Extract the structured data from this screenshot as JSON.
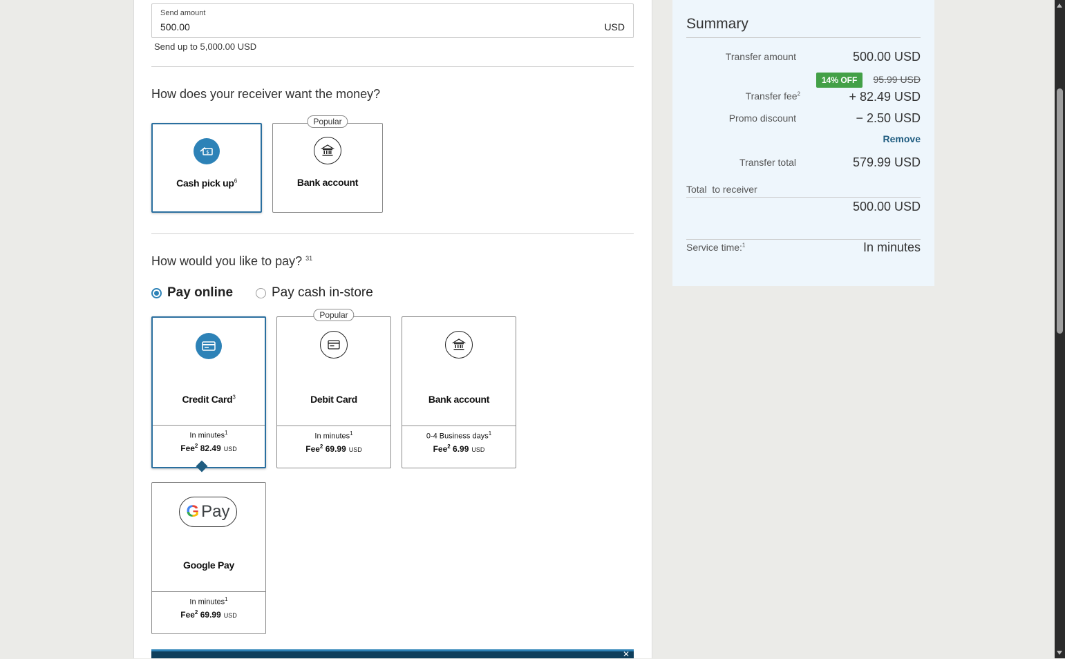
{
  "send": {
    "label": "Send amount",
    "value": "500.00",
    "currency": "USD",
    "limit": "Send up to 5,000.00 USD"
  },
  "receive": {
    "question": "How does your receiver want the money?",
    "options": [
      {
        "label": "Cash pick up",
        "sup": "6",
        "icon": "cash-hand-icon",
        "selected": true
      },
      {
        "label": "Bank account",
        "tag": "Popular",
        "icon": "bank-icon",
        "selected": false
      }
    ]
  },
  "pay": {
    "question": "How would you like to pay?",
    "question_sup": "31",
    "radios": {
      "online": "Pay online",
      "instore": "Pay cash in-store",
      "selected": "online"
    },
    "methods": [
      {
        "label": "Credit Card",
        "sup": "3",
        "icon": "credit-card-icon",
        "time": "In minutes",
        "time_sup": "1",
        "fee_label": "Fee",
        "fee_sup": "2",
        "fee": "82.49",
        "currency": "USD",
        "selected": true
      },
      {
        "label": "Debit Card",
        "tag": "Popular",
        "icon": "debit-card-icon",
        "time": "In minutes",
        "time_sup": "1",
        "fee_label": "Fee",
        "fee_sup": "2",
        "fee": "69.99",
        "currency": "USD"
      },
      {
        "label": "Bank account",
        "icon": "bank-icon",
        "time": "0-4 Business days",
        "time_sup": "1",
        "fee_label": "Fee",
        "fee_sup": "2",
        "fee": "6.99",
        "currency": "USD"
      },
      {
        "label": "Google Pay",
        "logo": "Pay",
        "icon": "google-pay-icon",
        "time": "In minutes",
        "time_sup": "1",
        "fee_label": "Fee",
        "fee_sup": "2",
        "fee": "69.99",
        "currency": "USD"
      }
    ]
  },
  "summary": {
    "title": "Summary",
    "transfer_amount_label": "Transfer amount",
    "transfer_amount": "500.00 USD",
    "discount_badge": "14% OFF",
    "original_fee": "95.99 USD",
    "transfer_fee_label": "Transfer fee",
    "transfer_fee_sup": "2",
    "transfer_fee": "+ 82.49 USD",
    "promo_label": "Promo discount",
    "promo_value": "− 2.50 USD",
    "remove": "Remove",
    "total_label": "Transfer total",
    "total_value": "579.99 USD",
    "receiver_label": "Total  to receiver",
    "receiver_value": "500.00 USD",
    "service_label": "Service time:",
    "service_sup": "1",
    "service_value": "In minutes"
  },
  "colors": {
    "accent": "#2d82b7",
    "badge_green": "#43a047",
    "summary_bg": "#eef6fc",
    "banner": "#0f3f5c"
  }
}
